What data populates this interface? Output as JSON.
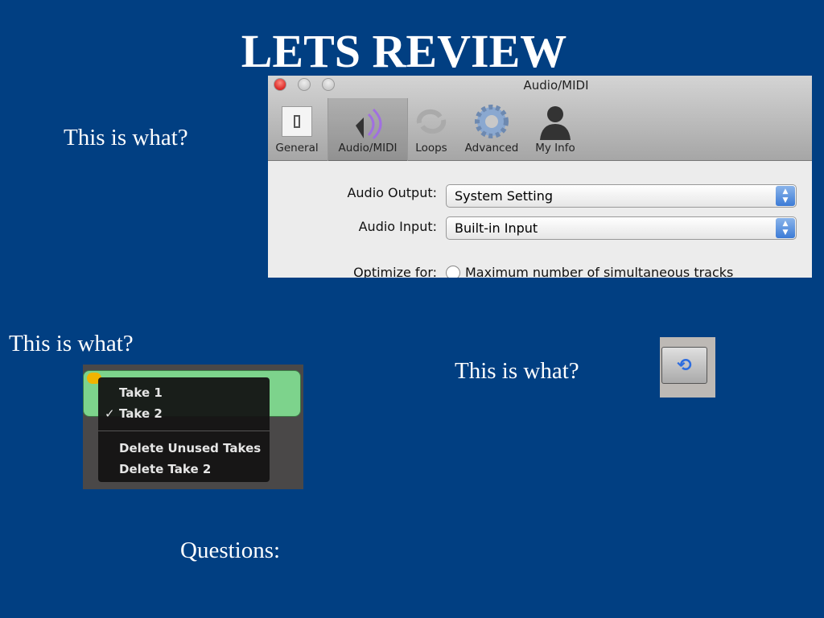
{
  "slide": {
    "title": "LETS REVIEW",
    "q1": "This is what?",
    "q2": "This is what?",
    "q3": "This is what?",
    "footer": "Questions:"
  },
  "prefs": {
    "window_title": "Audio/MIDI",
    "tabs": [
      {
        "label": "General",
        "icon": "switch-icon"
      },
      {
        "label": "Audio/MIDI",
        "icon": "speaker-icon"
      },
      {
        "label": "Loops",
        "icon": "loop-icon"
      },
      {
        "label": "Advanced",
        "icon": "gear-icon"
      },
      {
        "label": "My Info",
        "icon": "person-icon"
      }
    ],
    "audio_output_label": "Audio Output:",
    "audio_output_value": "System Setting",
    "audio_input_label": "Audio Input:",
    "audio_input_value": "Built-in Input",
    "optimize_label": "Optimize for:",
    "optimize_option": "Maximum number of simultaneous tracks"
  },
  "takes_menu": {
    "items": [
      "Take 1",
      "Take 2"
    ],
    "checked": "✓",
    "actions": [
      "Delete Unused Takes",
      "Delete Take 2"
    ]
  },
  "cycle_button": {
    "icon": "cycle-icon",
    "glyph": "⟲"
  }
}
